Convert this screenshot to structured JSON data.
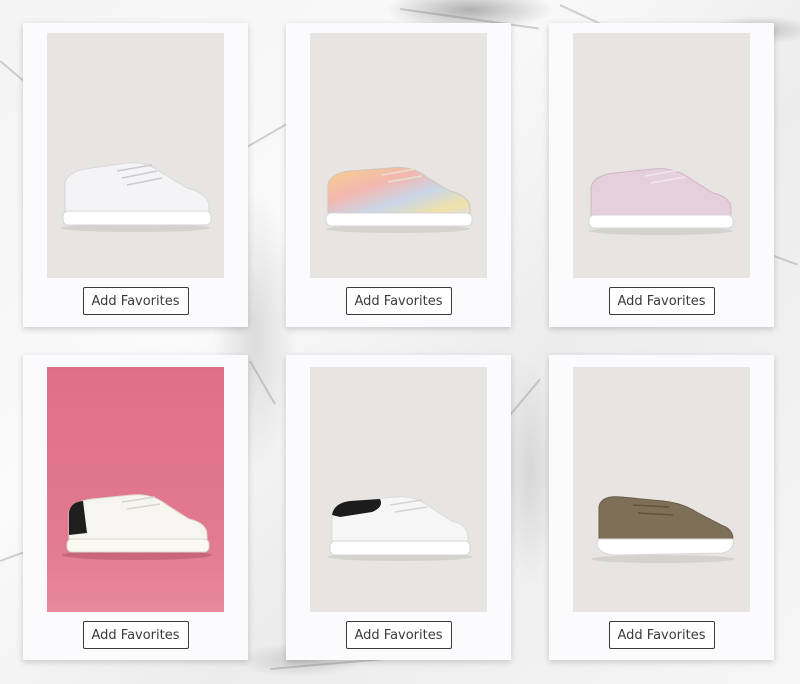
{
  "products": [
    {
      "button_label": "Add Favorites",
      "shoe": "white-canvas-sneaker"
    },
    {
      "button_label": "Add Favorites",
      "shoe": "pastel-tie-dye-sneaker"
    },
    {
      "button_label": "Add Favorites",
      "shoe": "light-pink-sneaker"
    },
    {
      "button_label": "Add Favorites",
      "shoe": "white-leather-sneaker-black-heel"
    },
    {
      "button_label": "Add Favorites",
      "shoe": "white-sneaker-black-collar"
    },
    {
      "button_label": "Add Favorites",
      "shoe": "khaki-knit-chunky-sneaker"
    }
  ],
  "colors": {
    "photo_background": "#e7e4e1",
    "pink_background": "#df6f87",
    "card_background": "#fbfafc",
    "button_border": "#3a3a3a"
  }
}
